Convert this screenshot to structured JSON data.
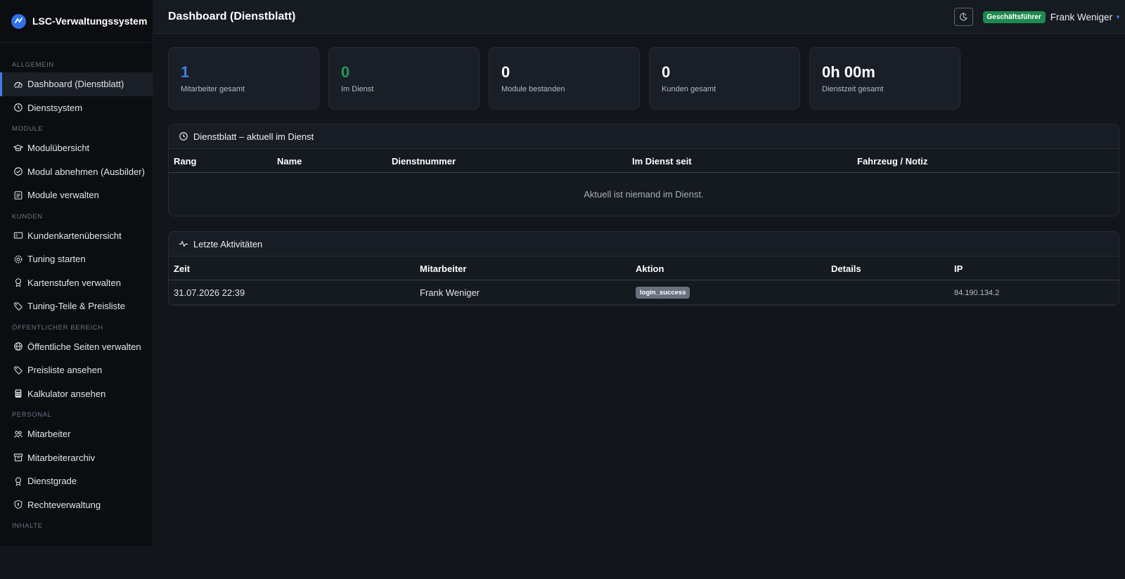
{
  "brand": {
    "title": "LSC-Verwaltungssystem",
    "logo_text": "LSC"
  },
  "sidebar": {
    "sections": [
      {
        "label": "ALLGEMEIN",
        "items": [
          {
            "label": "Dashboard (Dienstblatt)",
            "icon": "dashboard-gauge-icon",
            "active": true
          },
          {
            "label": "Dienstsystem",
            "icon": "clock-icon"
          }
        ]
      },
      {
        "label": "MODULE",
        "items": [
          {
            "label": "Modulübersicht",
            "icon": "graduation-cap-icon"
          },
          {
            "label": "Modul abnehmen (Ausbilder)",
            "icon": "check-circle-icon"
          },
          {
            "label": "Module verwalten",
            "icon": "list-document-icon"
          }
        ]
      },
      {
        "label": "KUNDEN",
        "items": [
          {
            "label": "Kundenkartenübersicht",
            "icon": "card-icon"
          },
          {
            "label": "Tuning starten",
            "icon": "gear-icon"
          },
          {
            "label": "Kartenstufen verwalten",
            "icon": "award-icon"
          },
          {
            "label": "Tuning-Teile & Preisliste",
            "icon": "tag-icon"
          }
        ]
      },
      {
        "label": "ÖFFENTLICHER BEREICH",
        "items": [
          {
            "label": "Öffentliche Seiten verwalten",
            "icon": "globe-icon"
          },
          {
            "label": "Preisliste ansehen",
            "icon": "tags-icon"
          },
          {
            "label": "Kalkulator ansehen",
            "icon": "calculator-icon"
          }
        ]
      },
      {
        "label": "PERSONAL",
        "items": [
          {
            "label": "Mitarbeiter",
            "icon": "people-icon"
          },
          {
            "label": "Mitarbeiterarchiv",
            "icon": "archive-icon"
          },
          {
            "label": "Dienstgrade",
            "icon": "award-icon"
          },
          {
            "label": "Rechteverwaltung",
            "icon": "shield-icon"
          }
        ]
      },
      {
        "label": "INHALTE",
        "items": []
      }
    ]
  },
  "header": {
    "title": "Dashboard (Dienstblatt)",
    "role_badge": "Geschäftsführer",
    "user_name": "Frank Weniger",
    "theme_toggle_icon": "moon-stars-icon"
  },
  "stats": [
    {
      "value": "1",
      "label": "Mitarbeiter gesamt",
      "color": "#3d7eea"
    },
    {
      "value": "0",
      "label": "Im Dienst",
      "color": "#249760"
    },
    {
      "value": "0",
      "label": "Module bestanden",
      "color": "#ffffff"
    },
    {
      "value": "0",
      "label": "Kunden gesamt",
      "color": "#ffffff"
    },
    {
      "value": "0h 00m",
      "label": "Dienstzeit gesamt",
      "color": "#ffffff"
    }
  ],
  "duty_panel": {
    "title": "Dienstblatt – aktuell im Dienst",
    "columns": [
      "Rang",
      "Name",
      "Dienstnummer",
      "Im Dienst seit",
      "Fahrzeug / Notiz"
    ],
    "empty_text": "Aktuell ist niemand im Dienst."
  },
  "activity_panel": {
    "title": "Letzte Aktivitäten",
    "columns": [
      "Zeit",
      "Mitarbeiter",
      "Aktion",
      "Details",
      "IP"
    ],
    "rows": [
      {
        "time": "31.07.2026 22:39",
        "employee": "Frank Weniger",
        "action": "login_success",
        "details": "",
        "ip": "84.190.134.2"
      }
    ]
  }
}
